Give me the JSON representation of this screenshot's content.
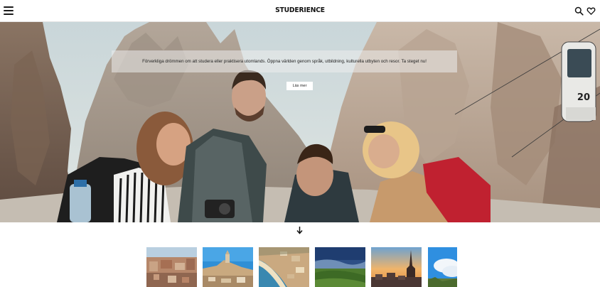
{
  "header": {
    "logo": "STUDERIENCE",
    "menu_icon": "hamburger-menu-icon",
    "search_icon": "search-icon",
    "favorites_icon": "heart-icon"
  },
  "hero": {
    "tagline": "Förverkliga drömmen om att studera eller praktisera utomlands. Öppna världen genom språk, utbildning, kulturella utbyten och resor. Ta steget nu!",
    "button_label": "Läs mer",
    "cable_car_number": "20"
  },
  "scroll_icon": "arrow-down-icon",
  "destinations": [
    {
      "name": "destination-thumb-1"
    },
    {
      "name": "destination-thumb-2"
    },
    {
      "name": "destination-thumb-3"
    },
    {
      "name": "destination-thumb-4"
    },
    {
      "name": "destination-thumb-5"
    },
    {
      "name": "destination-thumb-6"
    }
  ]
}
